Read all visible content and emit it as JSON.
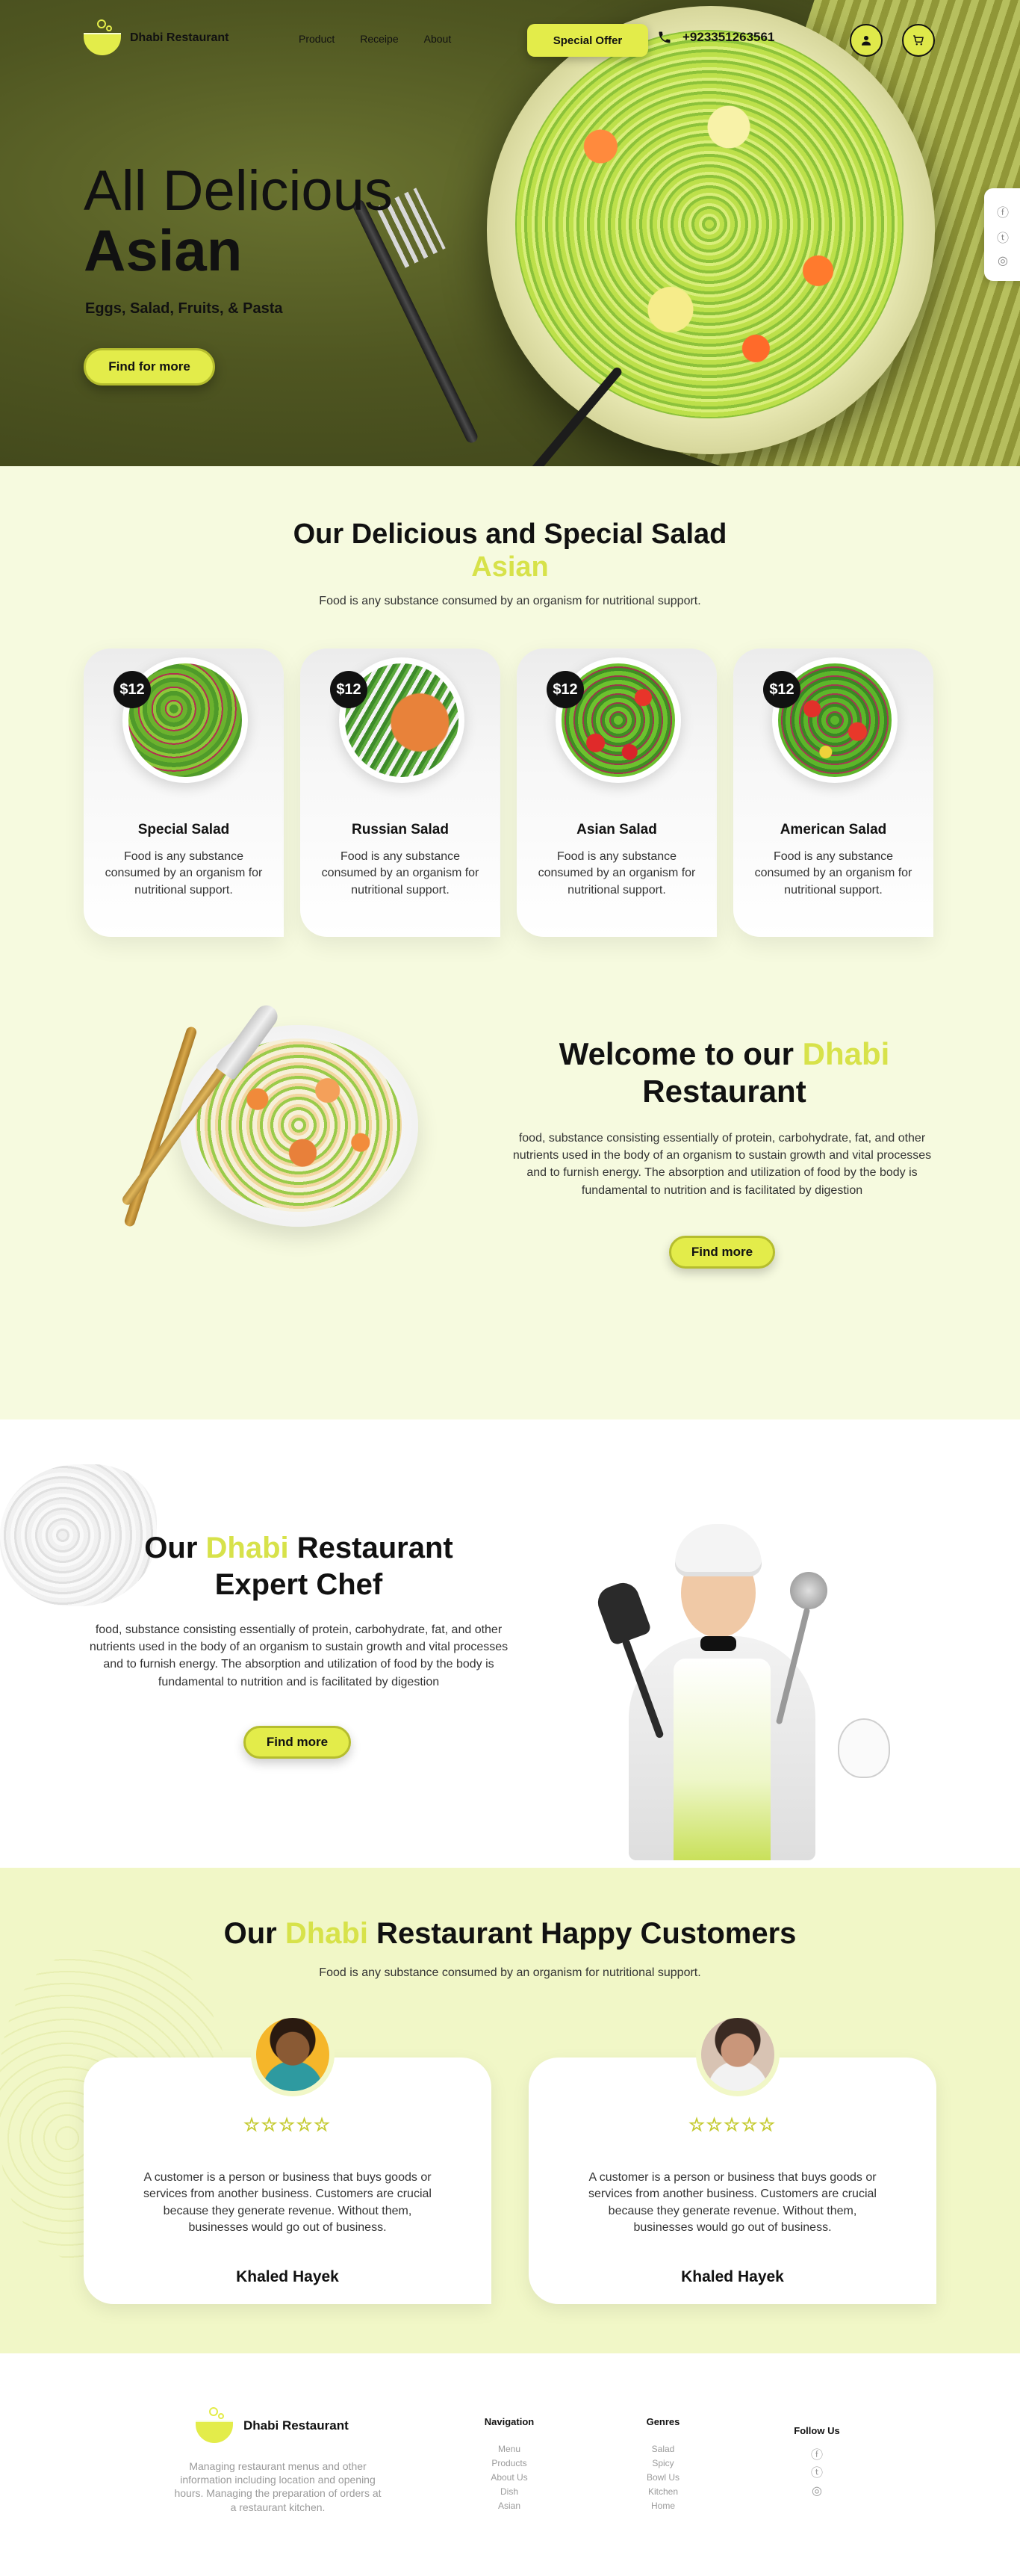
{
  "brand": {
    "name": "Dhabi Restaurant",
    "accent": "#e3ec4a",
    "dark": "#111111"
  },
  "nav": {
    "links": [
      "Product",
      "Receipe",
      "About"
    ],
    "offer_label": "Special Offer",
    "phone": "+923351263561",
    "icons": [
      "user-icon",
      "cart-icon",
      "phone-icon"
    ]
  },
  "hero": {
    "title_1": "All Delicious",
    "title_2": "Asian",
    "subtitle": "Eggs, Salad, Fruits, & Pasta",
    "button": "Find for more",
    "social_icons": [
      "facebook-icon",
      "twitter-icon",
      "instagram-icon"
    ]
  },
  "special": {
    "title": "Our Delicious and Special Salad",
    "title_accent": "Asian",
    "desc": "Food is any substance consumed by an organism for nutritional support.",
    "cards": [
      {
        "price": "$12",
        "name": "Special Salad",
        "desc": "Food is any substance consumed by an organism for nutritional support."
      },
      {
        "price": "$12",
        "name": "Russian Salad",
        "desc": "Food is any substance consumed by an organism for nutritional support."
      },
      {
        "price": "$12",
        "name": "Asian Salad",
        "desc": "Food is any substance consumed by an organism for nutritional support."
      },
      {
        "price": "$12",
        "name": "American Salad",
        "desc": "Food is any substance consumed by an organism for nutritional support."
      }
    ]
  },
  "welcome": {
    "title_pre": "Welcome to our ",
    "title_accent": "Dhabi",
    "title_post": "Restaurant",
    "desc": "food, substance consisting essentially of protein, carbohydrate, fat, and other nutrients used in the body of an organism to sustain growth and vital processes and to furnish energy. The absorption and utilization of food by the body is fundamental to nutrition and is facilitated by digestion",
    "button": "Find more"
  },
  "chef": {
    "title_pre": "Our ",
    "title_accent": "Dhabi",
    "title_post": " Restaurant",
    "title_line2": "Expert Chef",
    "desc": "food, substance consisting essentially of protein, carbohydrate, fat, and other nutrients used in the body of an organism to sustain growth and vital processes and to furnish energy. The absorption and utilization of food by the body is fundamental to nutrition and is facilitated by digestion",
    "button": "Find more"
  },
  "customers": {
    "title_pre": "Our ",
    "title_accent": "Dhabi",
    "title_post": " Restaurant Happy Customers",
    "desc": "Food is any substance consumed by an organism for nutritional support.",
    "reviews": [
      {
        "stars": "☆☆☆☆☆",
        "rating": 5,
        "text": "A customer is a person or business that buys goods or services from another business. Customers are crucial because they generate revenue. Without them, businesses would go out of business.",
        "name": "Khaled Hayek"
      },
      {
        "stars": "☆☆☆☆☆",
        "rating": 5,
        "text": "A customer is a person or business that buys goods or services from another business. Customers are crucial because they generate revenue. Without them, businesses would go out of business.",
        "name": "Khaled Hayek"
      }
    ]
  },
  "footer": {
    "brand": "Dhabi Restaurant",
    "desc": "Managing restaurant menus and other information including location and opening hours. Managing the preparation of orders at a restaurant kitchen.",
    "navigation": {
      "heading": "Navigation",
      "items": [
        "Menu",
        "Products",
        "About Us",
        "Dish",
        "Asian"
      ]
    },
    "genres": {
      "heading": "Genres",
      "items": [
        "Salad",
        "Spicy",
        "Bowl Us",
        "Kitchen",
        "Home"
      ]
    },
    "follow": {
      "heading": "Follow Us",
      "icons": [
        "facebook-icon",
        "twitter-icon",
        "instagram-icon"
      ]
    }
  }
}
